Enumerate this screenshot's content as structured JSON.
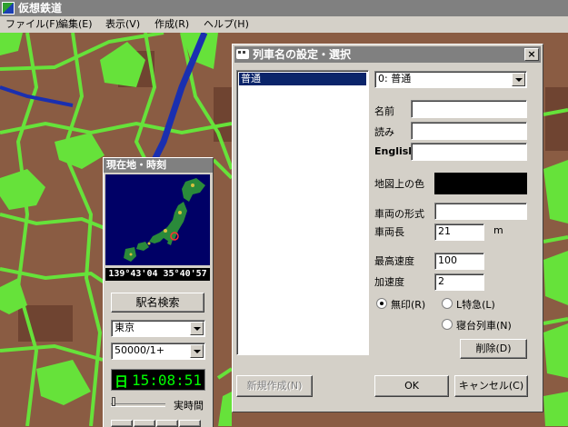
{
  "app": {
    "title": "仮想鉄道",
    "menu": [
      "ファイル(F)",
      "編集(E)",
      "表示(V)",
      "作成(R)",
      "ヘルプ(H)"
    ]
  },
  "location_panel": {
    "title": "現在地・時刻",
    "coordinates": "139°43'04 35°40'57",
    "station_search_button": "駅名検索",
    "station_select": "東京",
    "scale_select": "50000/1+",
    "clock_day": "日",
    "clock_time": "15:08:51",
    "realtime_label": "実時間"
  },
  "dialog": {
    "title": "列車名の設定・選択",
    "list_items": [
      "普通"
    ],
    "type_select": "0: 普通",
    "labels": {
      "name": "名前",
      "reading": "読み",
      "english": "English",
      "map_color": "地図上の色",
      "vehicle_type": "車両の形式",
      "car_length": "車両長",
      "max_speed": "最高速度",
      "acceleration": "加速度"
    },
    "values": {
      "name": "",
      "reading": "",
      "english": "",
      "vehicle_type": "",
      "car_length": "21",
      "car_length_unit": "m",
      "max_speed": "100",
      "acceleration": "2"
    },
    "map_color": "#000000",
    "radios": {
      "none": "無印(R)",
      "l_express": "L特急(L)",
      "sleeper": "寝台列車(N)"
    },
    "buttons": {
      "delete": "削除(D)",
      "new": "新規作成(N)",
      "ok": "OK",
      "cancel": "キャンセル(C)"
    }
  },
  "colors": {
    "terrain_brown": "#8a5c43",
    "terrain_dark": "#6a3f2c",
    "green": "#66e23a",
    "river": "#1a2fb0",
    "window_face": "#d4d0c8",
    "title_inactive": "#808080",
    "clock_bg": "#000000",
    "clock_fg": "#00ff00"
  }
}
